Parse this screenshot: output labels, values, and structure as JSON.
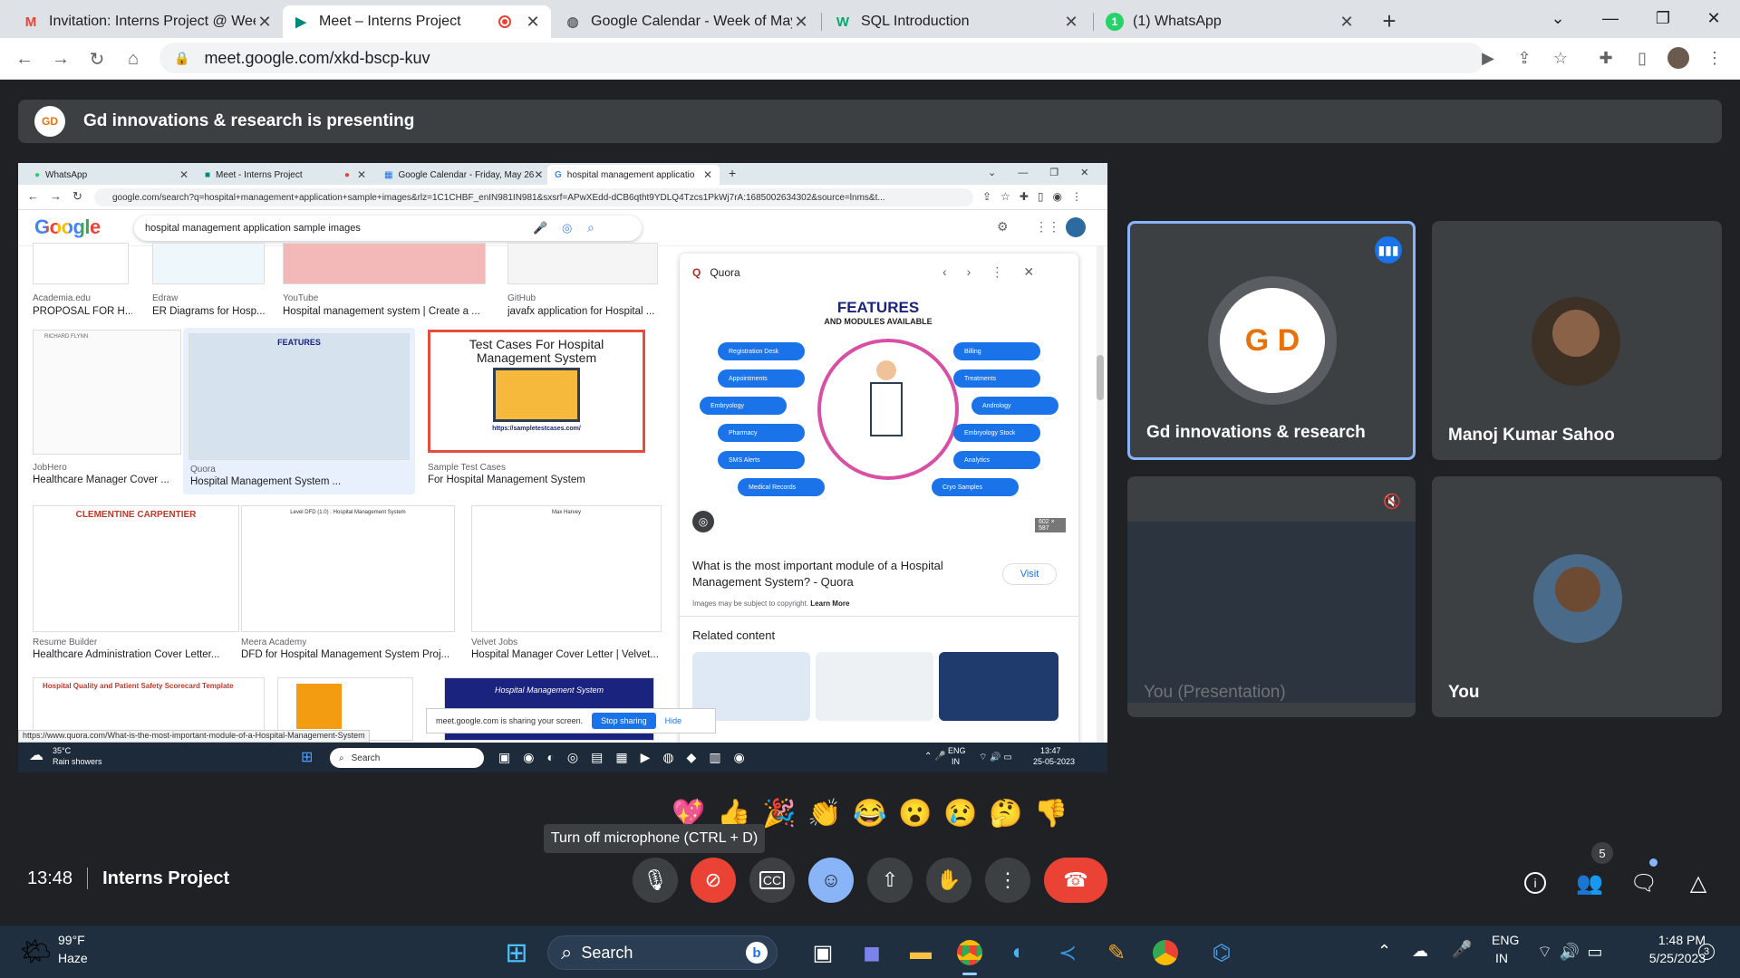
{
  "browser": {
    "tabs": [
      {
        "title": "Invitation: Interns Project @ Wee",
        "icon": "gmail-icon",
        "favicon": "M",
        "color": "#ea4335"
      },
      {
        "title": "Meet – Interns Project",
        "icon": "meet-icon",
        "favicon": "▶",
        "color": "#00897b"
      },
      {
        "title": "Google Calendar - Week of May",
        "icon": "globe-icon",
        "favicon": "◍",
        "color": "#5f6368"
      },
      {
        "title": "SQL Introduction",
        "icon": "w3schools-icon",
        "favicon": "W",
        "color": "#04aa6d"
      },
      {
        "title": "(1) WhatsApp",
        "icon": "whatsapp-icon",
        "favicon": "1",
        "color": "#25d366"
      }
    ],
    "url": "meet.google.com/xkd-bscp-kuv",
    "new_tab": "+",
    "controls": {
      "minimize": "—",
      "maximize": "❐",
      "close": "✕",
      "dropdown": "⌄"
    }
  },
  "meet": {
    "presenting_banner": "Gd innovations & research is presenting",
    "meeting_time": "13:48",
    "meeting_name": "Interns Project",
    "tooltip": "Turn off microphone (CTRL + D)",
    "reactions": [
      "💖",
      "👍",
      "🎉",
      "👏",
      "😂",
      "😮",
      "😢",
      "🤔",
      "👎"
    ],
    "people_count": "5",
    "participants": [
      {
        "name": "Gd innovations & research",
        "initials": "G D"
      },
      {
        "name": "Manoj Kumar Sahoo"
      },
      {
        "name": "You (Presentation)"
      },
      {
        "name": "You"
      }
    ],
    "colors": {
      "accent": "#8ab4f8",
      "end_call": "#ea4335",
      "tile": "#3c4043"
    }
  },
  "shared_screen": {
    "tabs": [
      {
        "title": "WhatsApp"
      },
      {
        "title": "Meet - Interns Project"
      },
      {
        "title": "Google Calendar - Friday, May 26"
      },
      {
        "title": "hospital management applicatio"
      }
    ],
    "url": "google.com/search?q=hospital+management+application+sample+images&rlz=1C1CHBF_enIN981IN981&sxsrf=APwXEdd-dCB6qtht9YDLQ4Tzcs1PkWj7rA:1685002634302&source=lnms&t...",
    "google_logo": "Google",
    "search_query": "hospital management application sample images",
    "results_row1": [
      {
        "source": "Academia.edu",
        "caption": "PROPOSAL FOR H..."
      },
      {
        "source": "Edraw",
        "caption": "ER Diagrams for Hosp..."
      },
      {
        "source": "YouTube",
        "caption": "Hospital management system | Create a ..."
      },
      {
        "source": "GitHub",
        "caption": "javafx application for Hospital ..."
      }
    ],
    "results_row2": [
      {
        "source": "JobHero",
        "caption": "Healthcare Manager Cover ...",
        "thumb_title": "RICHARD FLYNN"
      },
      {
        "source": "Quora",
        "caption": "Hospital Management System ...",
        "thumb_title": "FEATURES"
      },
      {
        "source": "Sample Test Cases",
        "caption": "For Hospital Management System",
        "thumb_title": "Test Cases For Hospital Management System",
        "thumb_url": "https://sampletestcases.com/"
      }
    ],
    "results_row3": [
      {
        "source": "Resume Builder",
        "caption": "Healthcare Administration Cover Letter...",
        "thumb_title": "CLEMENTINE CARPENTIER"
      },
      {
        "source": "Meera Academy",
        "caption": "DFD for Hospital Management System Proj...",
        "thumb_title": "Level DFD (1.0) : Hospital Management System"
      },
      {
        "source": "Velvet Jobs",
        "caption": "Hospital Manager Cover Letter | Velvet...",
        "thumb_title": "Max Harvey"
      }
    ],
    "results_row4_titles": [
      "Hospital Quality and Patient Safety Scorecard Template",
      "Hospital Management System"
    ],
    "panel": {
      "source": "Quora",
      "image_title": "FEATURES",
      "image_subtitle": "AND MODULES AVAILABLE",
      "left_modules": [
        "Registration Desk",
        "Appointments",
        "Embryology",
        "Pharmacy",
        "SMS Alerts",
        "Medical Records"
      ],
      "right_modules": [
        "Billing",
        "Treatments",
        "Andrology",
        "Embryology Stock",
        "Analytics",
        "Cryo Samples"
      ],
      "size": "602 × 587",
      "title": "What is the most important module of a Hospital Management System? - Quora",
      "visit": "Visit",
      "copyright": "Images may be subject to copyright.",
      "learn_more": "Learn More",
      "related": "Related content"
    },
    "status_url": "https://www.quora.com/What-is-the-most-important-module-of-a-Hospital-Management-System",
    "sharing_msg": "meet.google.com is sharing your screen.",
    "stop_sharing": "Stop sharing",
    "hide": "Hide",
    "taskbar": {
      "temp": "35°C",
      "weather": "Rain showers",
      "search": "Search",
      "lang1": "ENG",
      "lang2": "IN",
      "time": "13:47",
      "date": "25-05-2023"
    }
  },
  "taskbar": {
    "temp": "99°F",
    "weather": "Haze",
    "search": "Search",
    "lang1": "ENG",
    "lang2": "IN",
    "time": "1:48 PM",
    "date": "5/25/2023",
    "notif": "3"
  }
}
